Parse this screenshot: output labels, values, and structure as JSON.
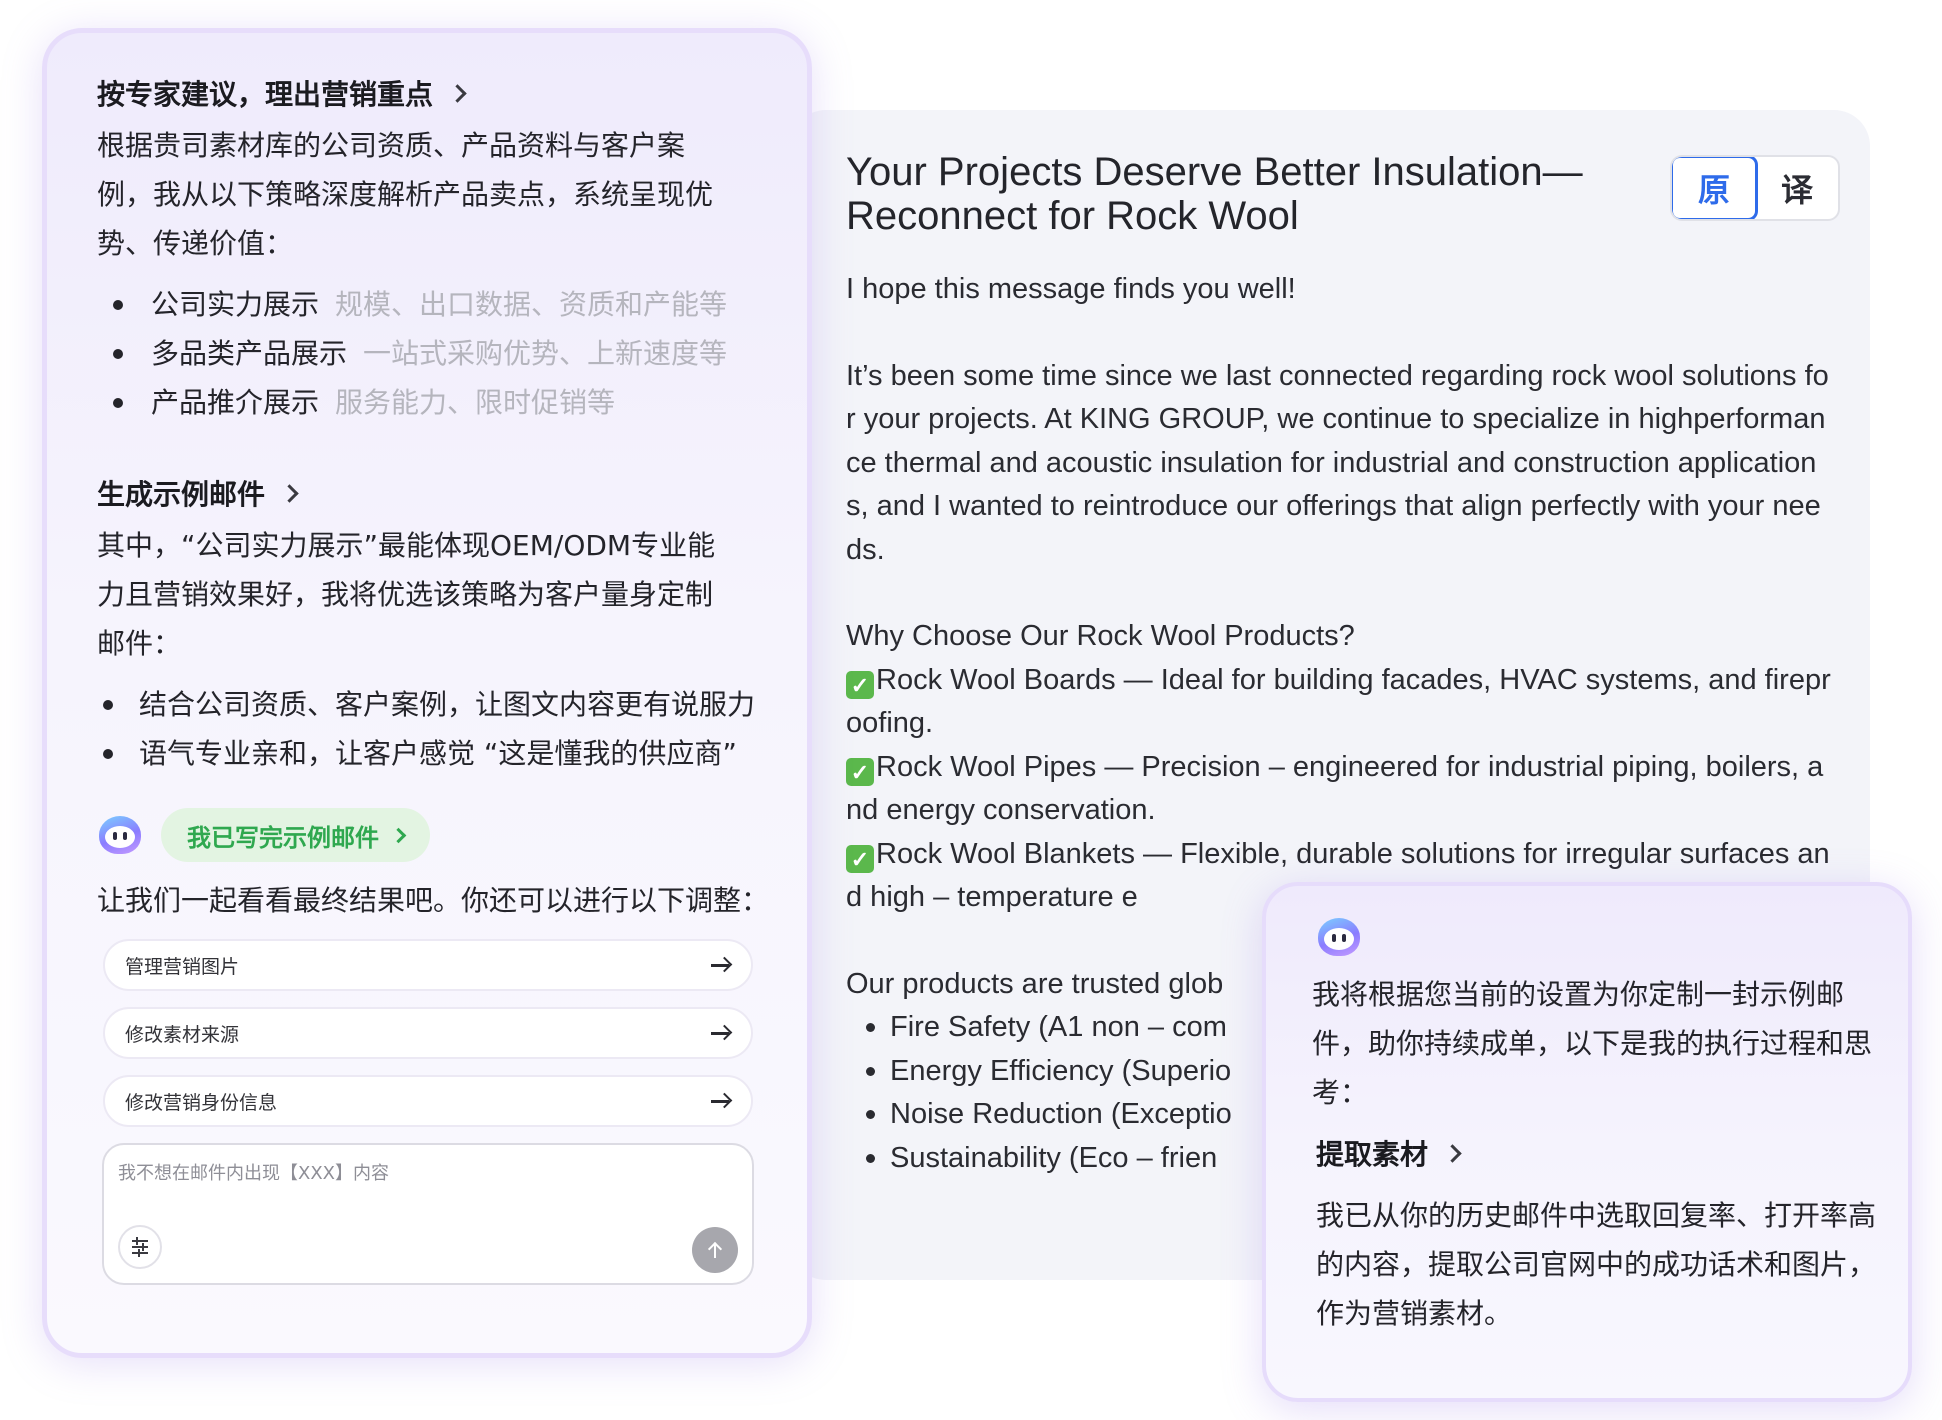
{
  "left_panel": {
    "section1": {
      "title": "按专家建议，理出营销重点",
      "intro": "根据贵司素材库的公司资质、产品资料与客户案例，我从以下策略深度解析产品卖点，系统呈现优势、传递价值：",
      "strategies": [
        {
          "label": "公司实力展示",
          "hint": "规模、出口数据、资质和产能等"
        },
        {
          "label": "多品类产品展示",
          "hint": "一站式采购优势、上新速度等"
        },
        {
          "label": "产品推介展示",
          "hint": "服务能力、限时促销等"
        }
      ]
    },
    "section2": {
      "title": "生成示例邮件",
      "intro": "其中，“公司实力展示”最能体现OEM/ODM专业能力且营销效果好，我将优选该策略为客户量身定制邮件：",
      "points": [
        "结合公司资质、客户案例，让图文内容更有说服力",
        "语气专业亲和，让客户感觉 “这是懂我的供应商”"
      ]
    },
    "done_pill": "我已写完示例邮件",
    "adjust_text": "让我们一起看看最终结果吧。你还可以进行以下调整：",
    "actions": [
      "管理营销图片",
      "修改素材来源",
      "修改营销身份信息"
    ],
    "input_placeholder": "我不想在邮件内出现【XXX】内容"
  },
  "email": {
    "title": "Your Projects Deserve Better Insulation—Reconnect for Rock Wool",
    "lang_original": "原",
    "lang_translate": "译",
    "greeting": "I hope this message finds you well!",
    "intro": "It’s been some time since we last connected regarding rock wool solutions for your projects. At KING GROUP, we continue to specialize in highperformance thermal and acoustic insulation for industrial and construction applications, and I wanted to reintroduce our offerings that align perfectly with your needs.",
    "why_heading": "Why Choose Our Rock Wool Products?",
    "features": [
      "Rock Wool Boards — Ideal for building facades, HVAC systems, and fireproofing.",
      "Rock Wool Pipes — Precision – engineered for industrial piping, boilers, and energy conservation.",
      "Rock Wool Blankets — Flexible, durable solutions for irregular surfaces and high – temperature e"
    ],
    "trusted": "Our products are trusted glob",
    "benefits": [
      "Fire Safety (A1 non – com",
      "Energy Efficiency (Superio",
      "Noise Reduction (Exceptio",
      "Sustainability (Eco – frien"
    ]
  },
  "assistant": {
    "message": "我将根据您当前的设置为你定制一封示例邮件，助你持续成单，以下是我的执行过程和思考：",
    "section_title": "提取素材",
    "section_body": "我已从你的历史邮件中选取回复率、打开率高的内容，提取公司官网中的成功话术和图片，作为营销素材。"
  }
}
